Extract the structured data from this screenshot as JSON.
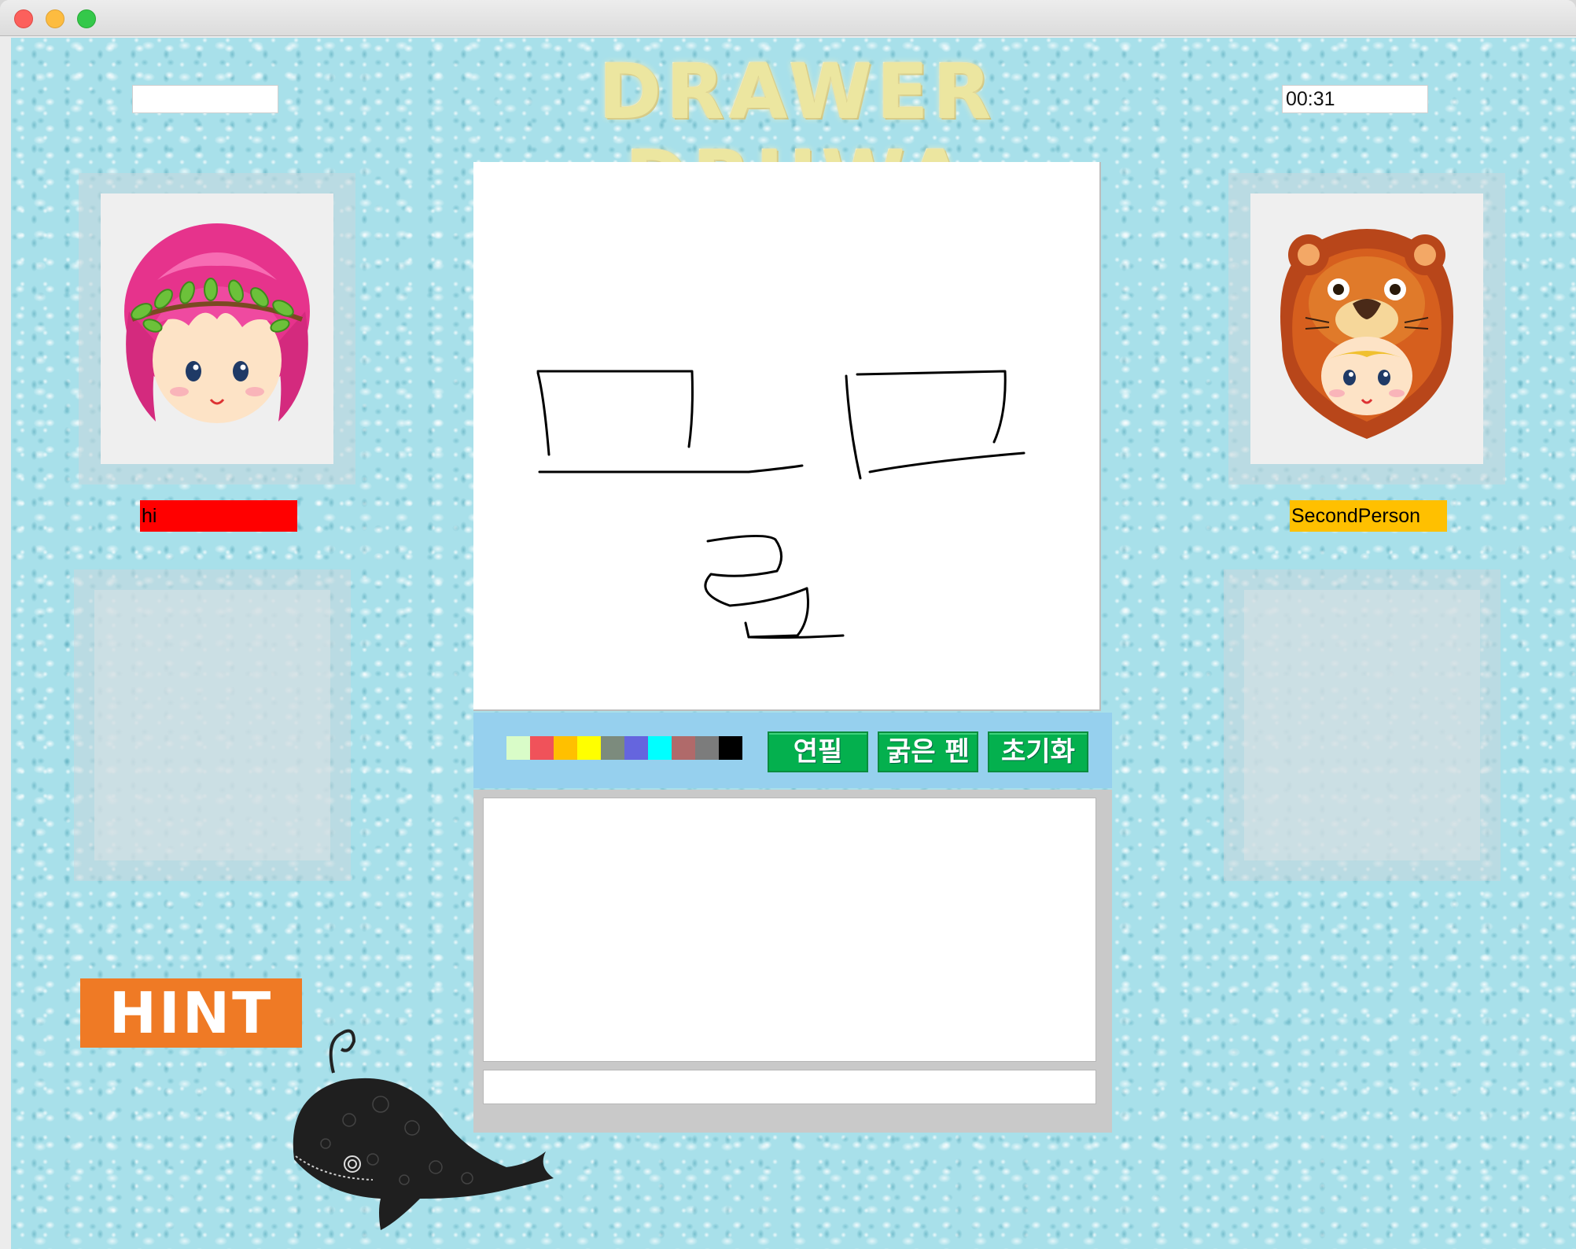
{
  "window": {
    "traffic_lights": [
      "close",
      "minimize",
      "maximize"
    ]
  },
  "header": {
    "title": "DRAWER DRUWA",
    "left_field_value": "",
    "timer": "00:31"
  },
  "players": {
    "left": {
      "name": "hi",
      "tag_color": "#ff0000",
      "avatar": "pink-haired-girl-with-leaf-crown"
    },
    "right": {
      "name": "SecondPerson",
      "tag_color": "#ffc000",
      "avatar": "lion-costume-kid"
    }
  },
  "palette": {
    "colors": [
      "#d9fcc8",
      "#f0525a",
      "#ffc000",
      "#ffff00",
      "#7c8b7d",
      "#6565de",
      "#00ffff",
      "#b06a6a",
      "#7c7c7c",
      "#000000"
    ]
  },
  "tools": {
    "pencil": "연필",
    "bold_pen": "굵은 펜",
    "reset": "초기화"
  },
  "chat": {
    "log": "",
    "input_value": ""
  },
  "hint": {
    "label": "HINT"
  },
  "colors": {
    "background": "#a8e0ea",
    "toolbar": "#96d0ee",
    "button_green": "#04b04e",
    "hint_orange": "#ef7a25",
    "title_gold": "#ece6a0"
  }
}
